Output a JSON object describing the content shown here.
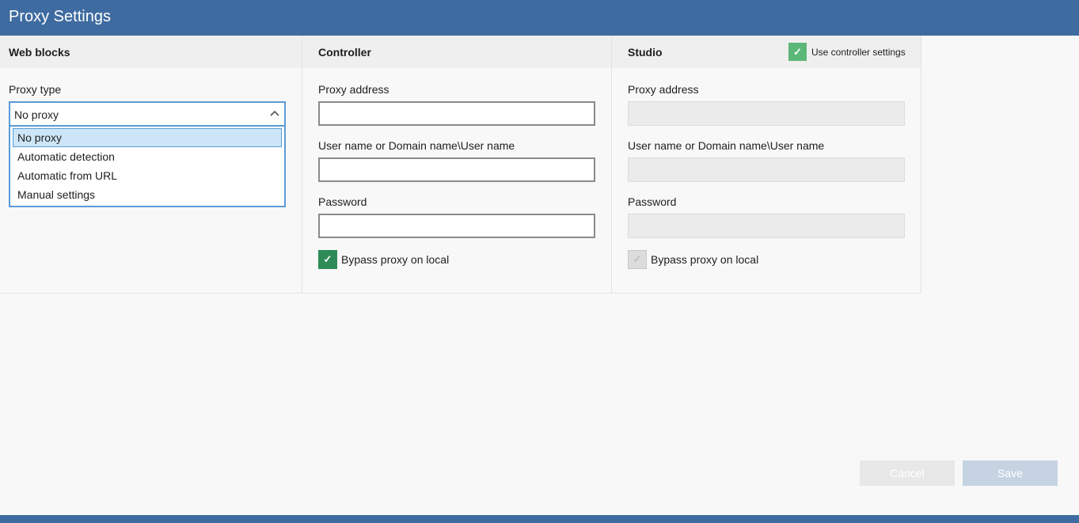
{
  "window": {
    "title": "Proxy Settings"
  },
  "web_blocks": {
    "heading": "Web blocks",
    "proxy_type_label": "Proxy type",
    "proxy_type_value": "No proxy",
    "options": [
      "No proxy",
      "Automatic detection",
      "Automatic from URL",
      "Manual settings"
    ],
    "chevron_icon": "chevron-up-icon"
  },
  "controller": {
    "heading": "Controller",
    "proxy_address_label": "Proxy address",
    "proxy_address_value": "",
    "username_label": "User name or Domain name\\User name",
    "username_value": "",
    "password_label": "Password",
    "password_value": "",
    "bypass_label": "Bypass proxy on local",
    "bypass_checked": true,
    "check_glyph": "✓"
  },
  "studio": {
    "heading": "Studio",
    "use_controller_label": "Use controller settings",
    "use_controller_checked": true,
    "proxy_address_label": "Proxy address",
    "username_label": "User name or Domain name\\User name",
    "password_label": "Password",
    "bypass_label": "Bypass proxy on local",
    "bypass_checked": true,
    "check_glyph": "✓"
  },
  "actions": {
    "cancel": "Cancel",
    "save": "Save"
  },
  "colors": {
    "titlebar": "#3e6ba0",
    "accent": "#5a9bd5",
    "check_on": "#2e8b57"
  }
}
